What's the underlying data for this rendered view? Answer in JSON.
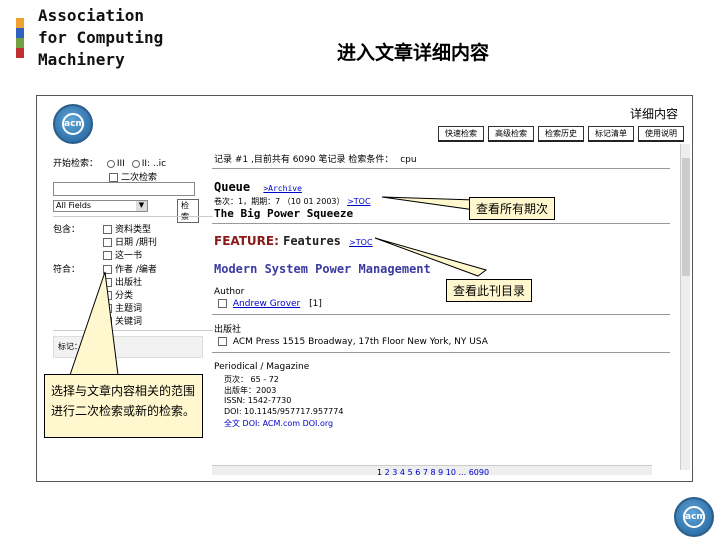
{
  "slide": {
    "org_lines": [
      "Association",
      "for Computing",
      "Machinery"
    ],
    "title": "进入文章详细内容",
    "stripe_colors": [
      "#f0a030",
      "#3060c0",
      "#70a040",
      "#c03030"
    ]
  },
  "screenshot": {
    "logo_text": "acm",
    "detail_label": "详细内容",
    "toolbar": [
      "快速检索",
      "高级检索",
      "检索历史",
      "标记清单",
      "使用说明"
    ],
    "left_panel": {
      "start_label": "开始检索：",
      "radio_a": "III",
      "radio_b": "II: ..ic",
      "second_search": "二次检索",
      "select_value": "All Fields",
      "search_button": "检索",
      "include_label": "包含：",
      "include_items": [
        "资料类型",
        "日期 /期刊",
        "这一书"
      ],
      "match_label": "符合：",
      "match_items": [
        "作者 /编者",
        "出版社",
        "分类",
        "主题词",
        "关键词"
      ],
      "mark_label": "标记："
    },
    "main": {
      "result_line": "记录 #1 ,目前共有 6090 笔记录 检索条件：",
      "query": "cpu",
      "journal": "Queue",
      "archive_link": ">Archive",
      "issue_line": "卷次：1，期期：7 （10 01 2003）",
      "toc_link": ">TOC",
      "article_title": "The Big Power Squeeze",
      "feature_label": "FEATURE:",
      "feature_value": "Features",
      "feature_toc": ">TOC",
      "headline": "Modern System Power Management",
      "author_label": "Author",
      "author_value": "Andrew Grover",
      "author_index": "[1]",
      "publisher_label": "出版社",
      "publisher_value": "ACM Press 1515 Broadway, 17th Floor New York, NY USA",
      "periodical_label": "Periodical / Magazine",
      "pages_line": "页次： 65 - 72",
      "year_line": "出版年：2003",
      "issn_line": "ISSN: 1542-7730",
      "doi_line": "DOI: 10.1145/957717.957774",
      "full_text_line": "全文 DOI: ACM.com  DOI.org"
    },
    "pager": {
      "pages": [
        "1",
        "2",
        "3",
        "4",
        "5",
        "6",
        "7",
        "8",
        "9",
        "10"
      ],
      "ellipsis": "...",
      "last": "6090"
    }
  },
  "callouts": {
    "all_issues": "查看所有期次",
    "toc": "查看此刊目录",
    "refine": "选择与文章内容相关的范围进行二次检索或新的检索。"
  }
}
